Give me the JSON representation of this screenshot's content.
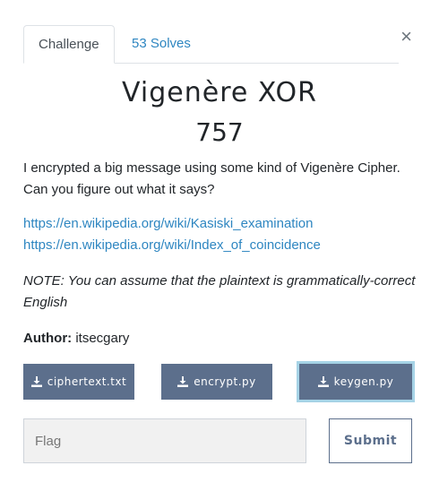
{
  "tabs": [
    {
      "label": "Challenge"
    },
    {
      "label": "53 Solves"
    }
  ],
  "close_label": "×",
  "challenge": {
    "title": "Vigenère XOR",
    "value": "757",
    "description": "I encrypted a big message using some kind of Vigenère Cipher. Can you figure out what it says?",
    "links": [
      "https://en.wikipedia.org/wiki/Kasiski_examination",
      "https://en.wikipedia.org/wiki/Index_of_coincidence"
    ],
    "note": "NOTE: You can assume that the plaintext is grammatically-correct English",
    "author_label": "Author:",
    "author_name": "itsecgary"
  },
  "files": [
    {
      "label": "ciphertext.txt"
    },
    {
      "label": "encrypt.py"
    },
    {
      "label": "keygen.py"
    }
  ],
  "flag_input": {
    "placeholder": "Flag",
    "value": ""
  },
  "submit_label": "Submit",
  "colors": {
    "link": "#2e86c1",
    "button": "#5c6f8c",
    "focus_outline": "#a6d3e6"
  },
  "icons": {
    "download": "download-icon",
    "close": "close-icon"
  }
}
